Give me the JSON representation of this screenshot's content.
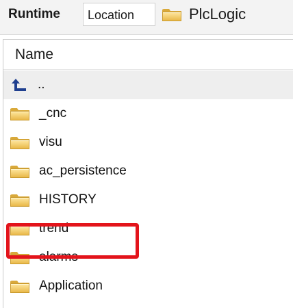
{
  "toolbar": {
    "runtime_tab": "Runtime",
    "location_tab": "Location",
    "path_label": "PlcLogic",
    "path_icon": "folder-icon"
  },
  "panel": {
    "column_header": "Name",
    "rows": [
      {
        "label": "..",
        "icon": "parent-directory-icon"
      },
      {
        "label": "_cnc",
        "icon": "folder-icon"
      },
      {
        "label": "visu",
        "icon": "folder-icon"
      },
      {
        "label": "ac_persistence",
        "icon": "folder-icon"
      },
      {
        "label": "HISTORY",
        "icon": "folder-icon",
        "highlighted": true
      },
      {
        "label": "trend",
        "icon": "folder-icon"
      },
      {
        "label": "alarms",
        "icon": "folder-icon"
      },
      {
        "label": "Application",
        "icon": "folder-icon"
      }
    ]
  },
  "colors": {
    "highlight": "#e3141b",
    "folder_yellow": "#f2c94c",
    "up_arrow": "#1f3f8f",
    "parent_row_bg": "#eeeeee"
  }
}
